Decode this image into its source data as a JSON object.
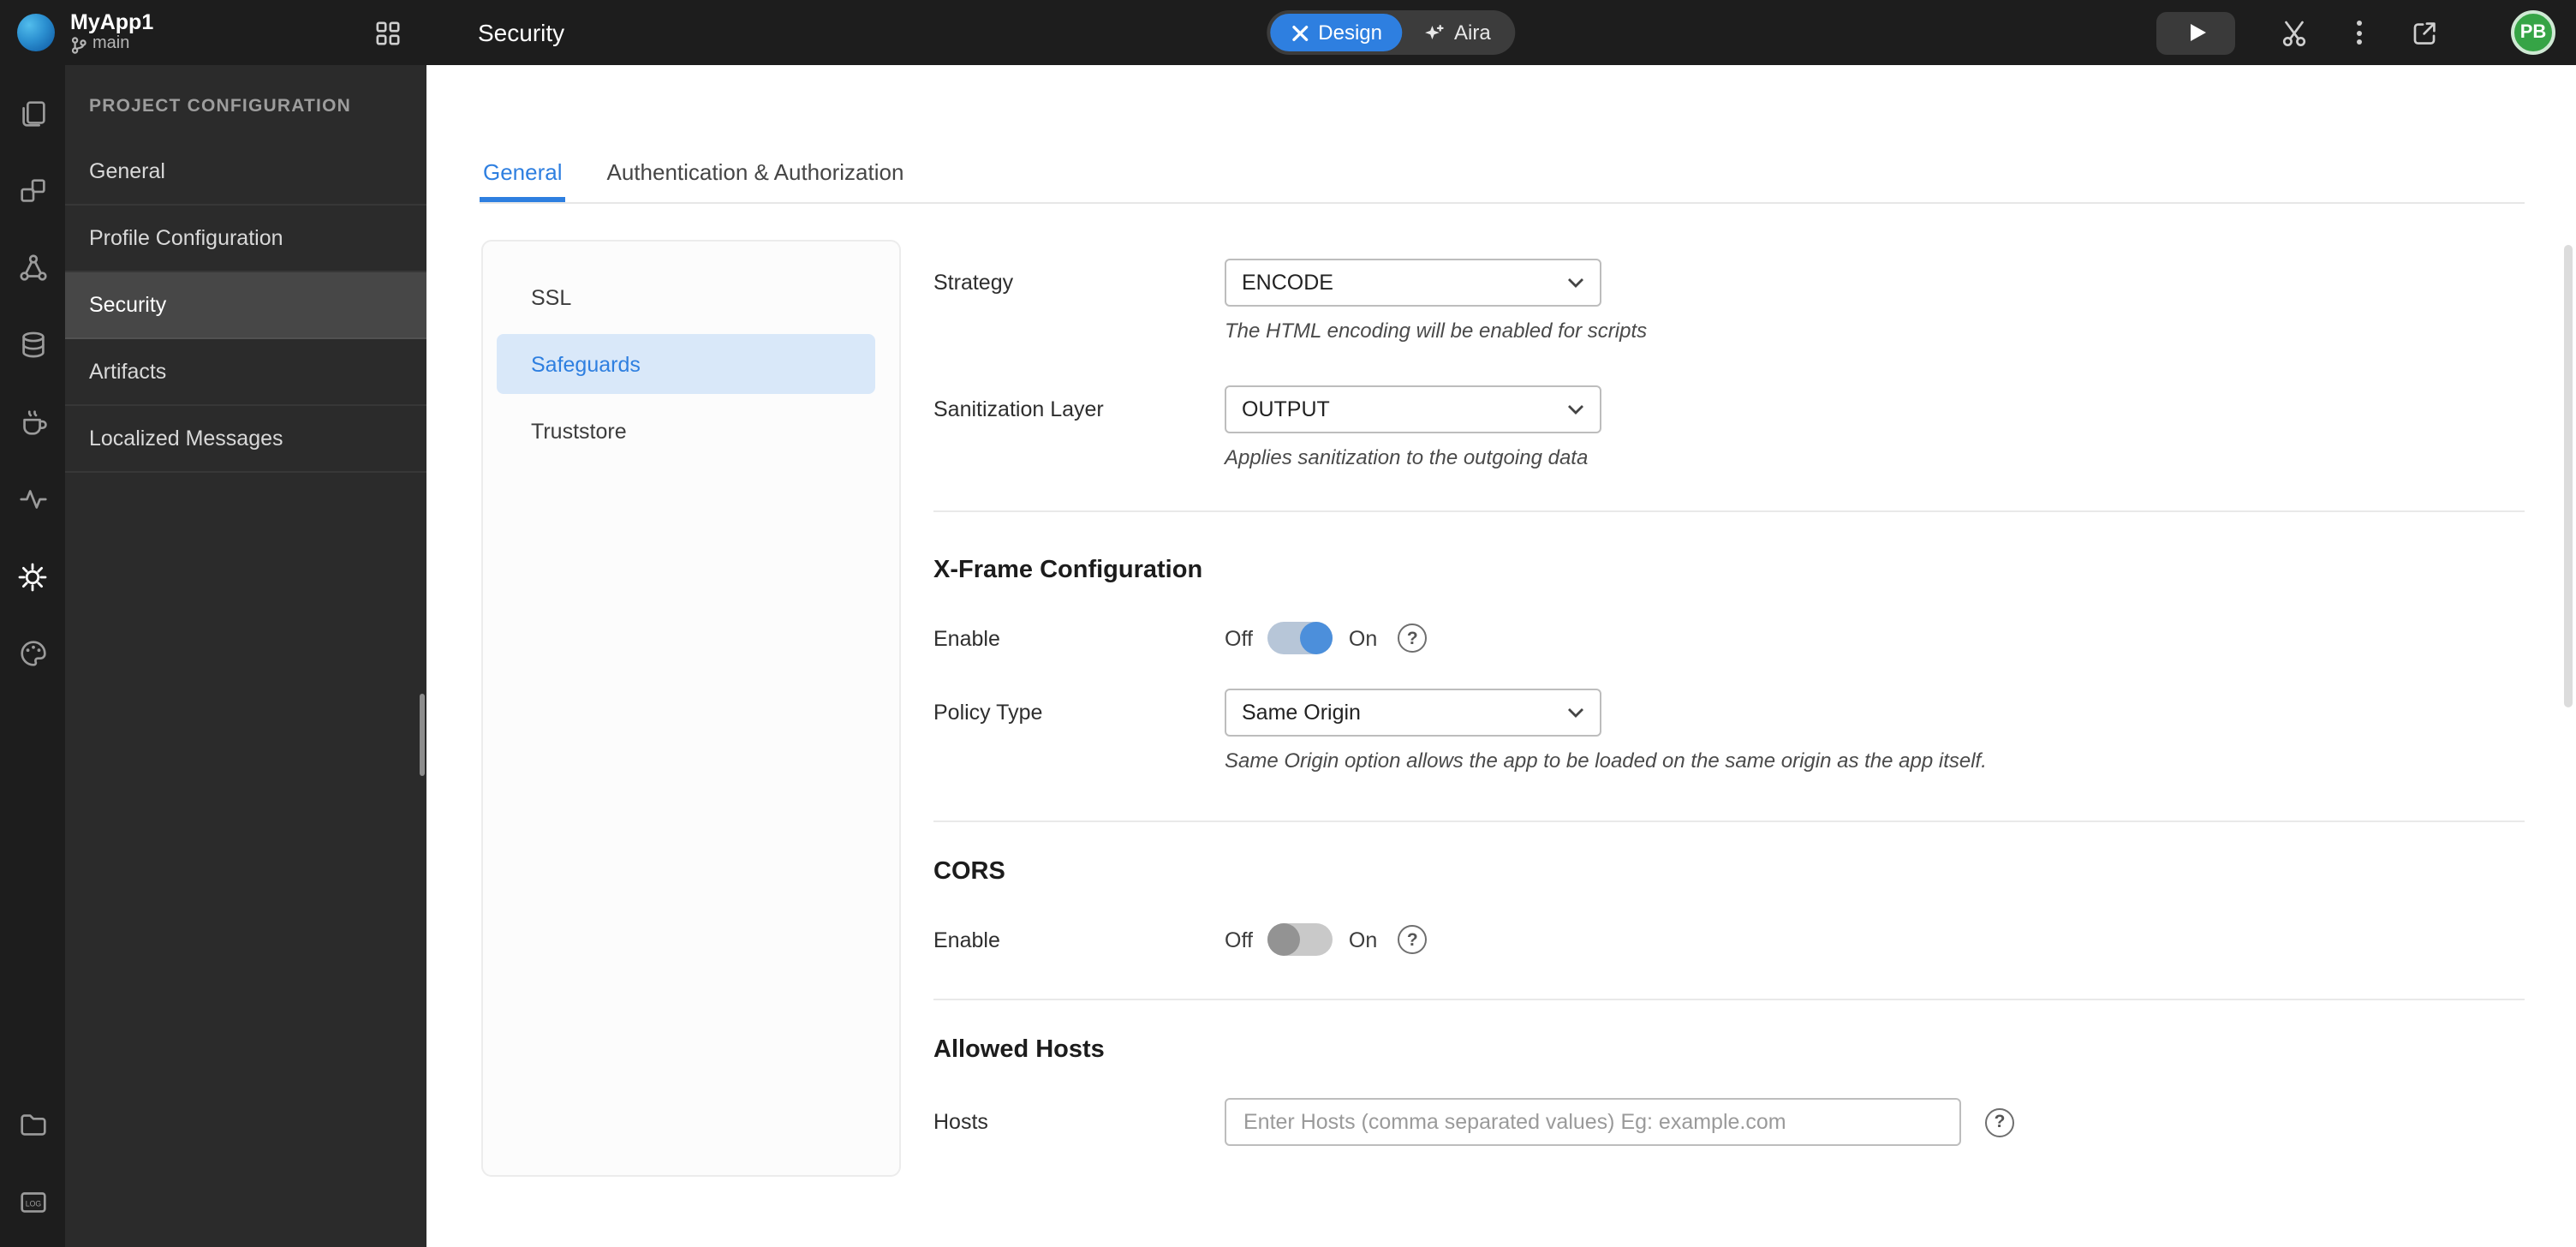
{
  "topbar": {
    "app_name": "MyApp1",
    "branch_name": "main",
    "page_title": "Security",
    "modes": {
      "design": "Design",
      "aira": "Aira"
    },
    "avatar_initials": "PB"
  },
  "rail_icons": [
    "pages",
    "widgets",
    "prefabs",
    "database",
    "java-services",
    "apis",
    "settings",
    "themes",
    "files",
    "logs"
  ],
  "sidebar": {
    "section_title": "PROJECT CONFIGURATION",
    "items": [
      {
        "label": "General",
        "active": false
      },
      {
        "label": "Profile Configuration",
        "active": false
      },
      {
        "label": "Security",
        "active": true
      },
      {
        "label": "Artifacts",
        "active": false
      },
      {
        "label": "Localized Messages",
        "active": false
      }
    ]
  },
  "tabs": [
    {
      "label": "General",
      "active": true
    },
    {
      "label": "Authentication & Authorization",
      "active": false
    }
  ],
  "subnav": [
    {
      "label": "SSL",
      "active": false
    },
    {
      "label": "Safeguards",
      "active": true
    },
    {
      "label": "Truststore",
      "active": false
    }
  ],
  "labels": {
    "off": "Off",
    "on": "On"
  },
  "form": {
    "strategy": {
      "label": "Strategy",
      "value": "ENCODE",
      "help": "The HTML encoding will be enabled for scripts"
    },
    "sanitization_layer": {
      "label": "Sanitization Layer",
      "value": "OUTPUT",
      "help": "Applies sanitization to the outgoing data"
    },
    "xframe": {
      "heading": "X-Frame Configuration",
      "enable_label": "Enable",
      "enabled": true,
      "policy_type": {
        "label": "Policy Type",
        "value": "Same Origin",
        "help": "Same Origin option allows the app to be loaded on the same origin as the app itself."
      }
    },
    "cors": {
      "heading": "CORS",
      "enable_label": "Enable",
      "enabled": false
    },
    "allowed_hosts": {
      "heading": "Allowed Hosts",
      "label": "Hosts",
      "placeholder": "Enter Hosts (comma separated values) Eg: example.com"
    }
  },
  "icons": {
    "help": "?",
    "logs_label": "LOG"
  },
  "colors": {
    "accent_blue": "#2e7fe0",
    "toggle_on_blue": "#4c8fdb",
    "avatar_green": "#36a446",
    "topbar_bg": "#1d1d1d",
    "sidebar_bg": "#2b2b2b",
    "subnav_active_bg": "#d9e8f9"
  }
}
